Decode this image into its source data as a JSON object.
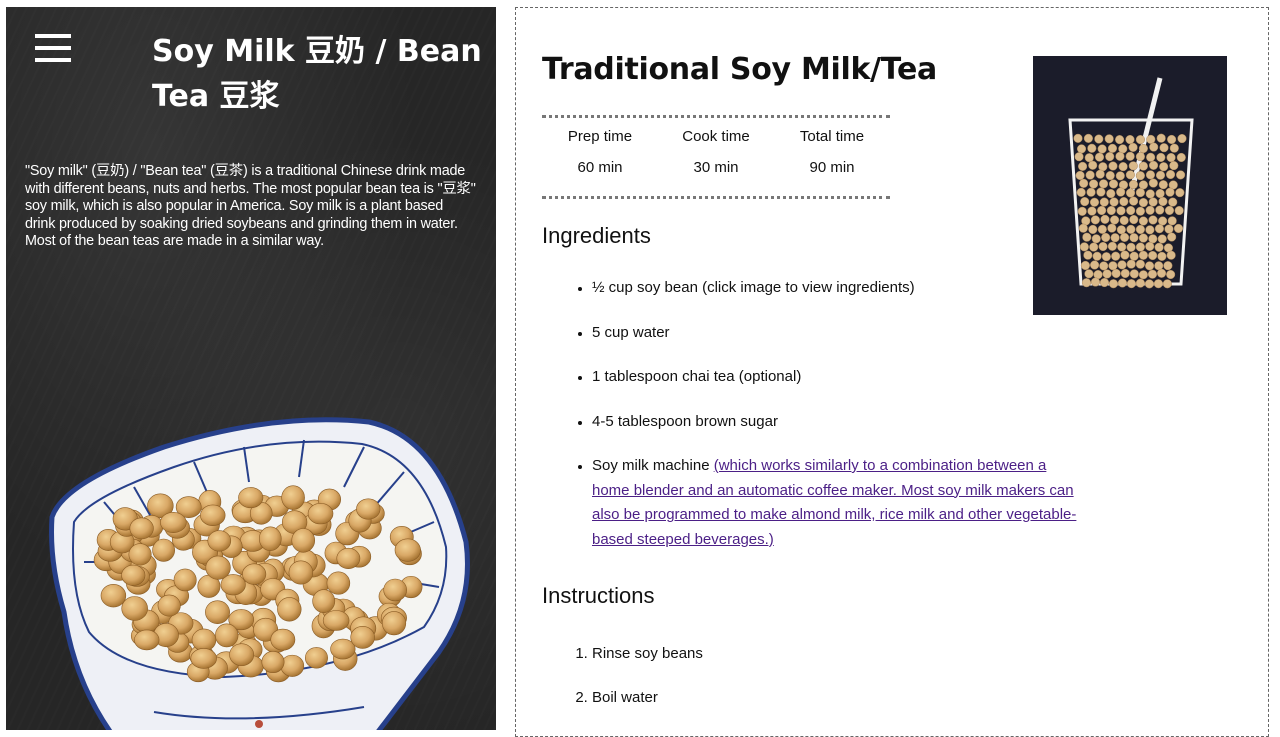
{
  "left": {
    "title": "Soy Milk 豆奶 / Bean Tea 豆浆",
    "description": "\"Soy milk\" (豆奶)   /  \"Bean tea\" (豆茶)  is a traditional Chinese drink made with different beans, nuts and herbs. The most popular bean tea is \"豆浆\" soy milk, which is also popular in America. Soy milk is a plant based drink produced by soaking dried soybeans and grinding them in water. Most of the bean teas are made in a similar way."
  },
  "recipe": {
    "title": "Traditional Soy Milk/Tea",
    "times": [
      {
        "label": "Prep time",
        "value": "60 min"
      },
      {
        "label": "Cook time",
        "value": "30 min"
      },
      {
        "label": "Total time",
        "value": "90 min"
      }
    ],
    "ingredients_heading": "Ingredients",
    "ingredients": [
      "½ cup soy bean (click image to view ingredients)",
      "5 cup water",
      "1 tablespoon chai tea (optional)",
      "4-5 tablespoon brown sugar"
    ],
    "machine": {
      "text": "Soy milk machine ",
      "link": "(which works similarly to a combination between a home blender and an automatic coffee maker. Most soy milk makers can also be programmed to make almond milk, rice milk and other vegetable-based steeped beverages.)"
    },
    "instructions_heading": "Instructions",
    "instructions": [
      "Rinse soy beans",
      "Boil water"
    ]
  },
  "colors": {
    "left_bg": "#262626",
    "link": "#4b1f86",
    "thumb_bg": "#1b1c2a",
    "bean": "#d9a866"
  },
  "icons": [
    "hamburger-menu-icon"
  ]
}
